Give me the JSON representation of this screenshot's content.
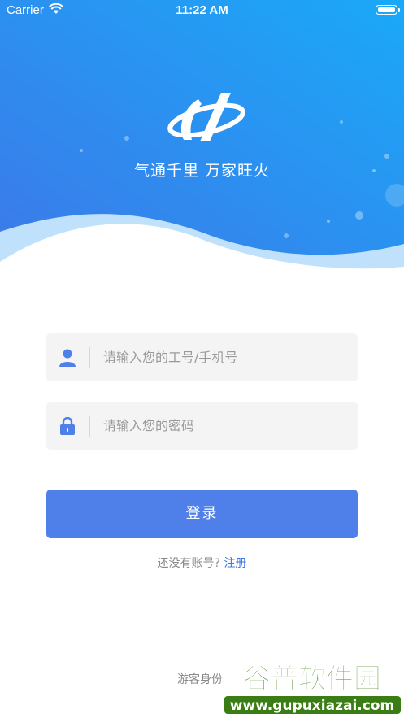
{
  "status_bar": {
    "carrier": "Carrier",
    "time": "11:22 AM"
  },
  "hero": {
    "slogan": "气通千里 万家旺火"
  },
  "form": {
    "account_placeholder": "请输入您的工号/手机号",
    "password_placeholder": "请输入您的密码"
  },
  "login_button": "登录",
  "register": {
    "prompt": "还没有账号?",
    "link": "注册"
  },
  "guest": "游客身份",
  "watermark": {
    "title": "谷普软件园",
    "url": "www.gupuxiazai.com"
  },
  "colors": {
    "hero_top": "#1aa9f8",
    "hero_bottom": "#3d7ae8",
    "button": "#4f7fe9",
    "link": "#3e78e6"
  }
}
